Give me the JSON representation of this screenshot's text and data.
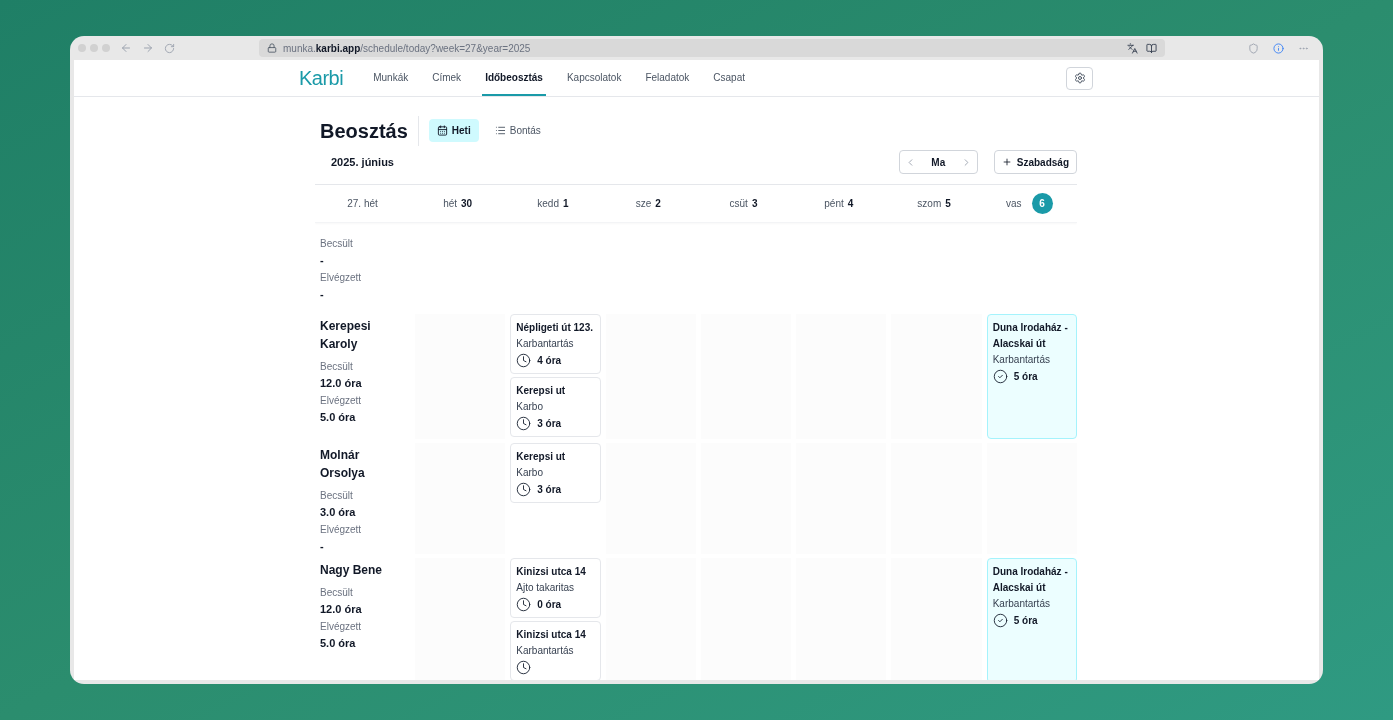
{
  "browser": {
    "url": "munka.**karbi.app**/schedule/today?week=27&year=2025"
  },
  "nav": {
    "logo": "Karbi",
    "items": [
      {
        "label": "Munkák",
        "selected": false
      },
      {
        "label": "Címek",
        "selected": false
      },
      {
        "label": "Időbeosztás",
        "selected": true
      },
      {
        "label": "Kapcsolatok",
        "selected": false
      },
      {
        "label": "Feladatok",
        "selected": false
      },
      {
        "label": "Csapat",
        "selected": false
      }
    ]
  },
  "page": {
    "title": "Beosztás",
    "views": [
      {
        "label": "Heti",
        "kind": "calendar",
        "selected": true
      },
      {
        "label": "Bontás",
        "kind": "list",
        "selected": false
      }
    ],
    "month": "2025. június",
    "today_button": "Ma",
    "leave_button": "Szabadság"
  },
  "week_label": "27. hét",
  "days": [
    {
      "name": "hét",
      "number": "30",
      "selected": false
    },
    {
      "name": "kedd",
      "number": "1",
      "selected": false
    },
    {
      "name": "sze",
      "number": "2",
      "selected": false
    },
    {
      "name": "csüt",
      "number": "3",
      "selected": false
    },
    {
      "name": "pént",
      "number": "4",
      "selected": false
    },
    {
      "name": "szom",
      "number": "5",
      "selected": false
    },
    {
      "name": "vas",
      "number": "6",
      "selected": true
    }
  ],
  "rows": [
    {
      "estimated_label": "Becsült",
      "estimated": "-",
      "done_label": "Elvégzett",
      "done": "-",
      "cells": [
        [],
        [],
        [],
        [],
        [],
        [],
        []
      ]
    },
    {
      "name": "Kerepesi Karoly",
      "estimated_label": "Becsült",
      "estimated": "12.0 óra",
      "done_label": "Elvégzett",
      "done": "5.0 óra",
      "cells": [
        [],
        [
          {
            "title": "Népligeti út 123.",
            "type": "Karbantartás",
            "hours": "4 óra",
            "completed": false
          },
          {
            "title": "Kerepsi ut",
            "type": "Karbo",
            "hours": "3 óra",
            "completed": false
          }
        ],
        [],
        [],
        [],
        [],
        [
          {
            "title": "Duna Irodaház - Alacskai út",
            "type": "Karbantartás",
            "hours": "5 óra",
            "completed": true
          }
        ]
      ]
    },
    {
      "name": "Molnár Orsolya",
      "estimated_label": "Becsült",
      "estimated": "3.0 óra",
      "done_label": "Elvégzett",
      "done": "-",
      "cells": [
        [],
        [
          {
            "title": "Kerepsi ut",
            "type": "Karbo",
            "hours": "3 óra",
            "completed": false
          }
        ],
        [],
        [],
        [],
        [],
        []
      ]
    },
    {
      "name": "Nagy Bene",
      "estimated_label": "Becsült",
      "estimated": "12.0 óra",
      "done_label": "Elvégzett",
      "done": "5.0 óra",
      "cells": [
        [],
        [
          {
            "title": "Kinizsi utca 14",
            "type": "Ajto takaritas",
            "hours": "0 óra",
            "completed": false
          },
          {
            "title": "Kinizsi utca 14",
            "type": "Karbantartás",
            "completed": false
          }
        ],
        [],
        [],
        [],
        [],
        [
          {
            "title": "Duna Irodaház - Alacskai út",
            "type": "Karbantartás",
            "hours": "5 óra",
            "completed": true
          }
        ]
      ]
    }
  ]
}
